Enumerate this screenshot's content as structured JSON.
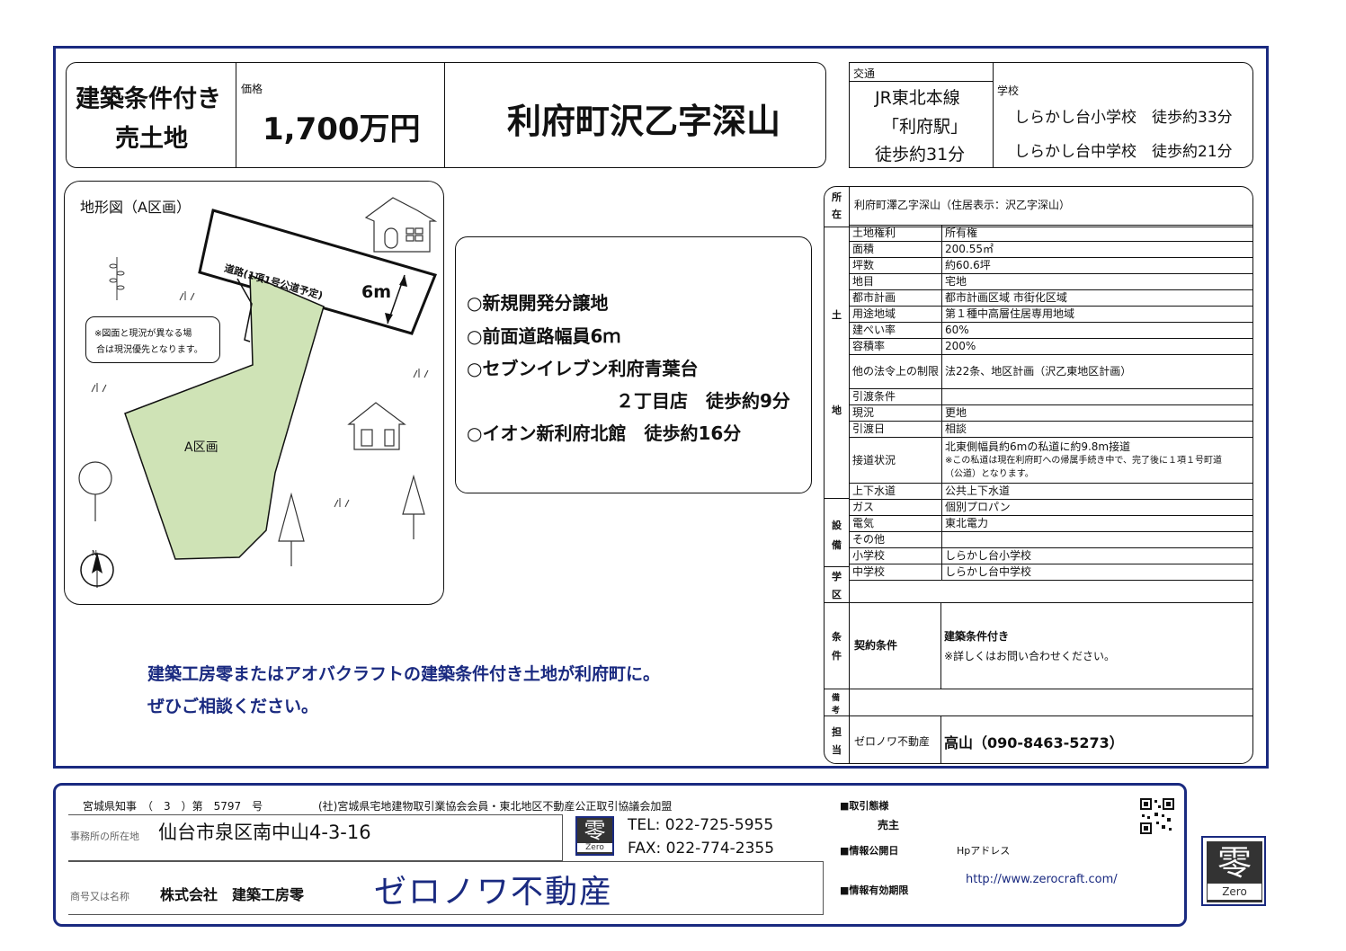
{
  "header": {
    "type_line1": "建築条件付き",
    "type_line2": "売土地",
    "price_label": "価格",
    "price": "1,700万円",
    "location_title": "利府町沢乙字深山",
    "transport_label": "交通",
    "transport_line1": "JR東北本線",
    "transport_line2": "「利府駅」",
    "transport_line3": "徒歩約31分",
    "school_label": "学校",
    "school_line1": "しらかし台小学校　徒歩約33分",
    "school_line2": "しらかし台中学校　徒歩約21分"
  },
  "map": {
    "title": "地形図（A区画）",
    "road_label": "道路(1項1号公道予定)",
    "road_width": "6m",
    "note_line1": "※図面と現況が異なる場",
    "note_line2": "合は現況優先となります。",
    "lot_label": "A区画",
    "north_label": "N"
  },
  "features": [
    "○新規開発分譲地",
    "○前面道路幅員6ｍ",
    "○セブンイレブン利府青葉台",
    "２丁目店　徒歩約9分",
    "○イオン新利府北館　徒歩約16分"
  ],
  "promo": {
    "line1": "建築工房零またはアオバクラフトの建築条件付き土地が利府町に。",
    "line2": "ぜひご相談ください。"
  },
  "spec": {
    "location_label_a": "所",
    "location_label_b": "在",
    "location_value": "利府町澤乙字深山（住居表示：沢乙字深山）",
    "land_group_label_a": "土",
    "land_group_label_b": "地",
    "land_rows": [
      {
        "label": "土地権利",
        "value": "所有権"
      },
      {
        "label": "面積",
        "value": "200.55㎡"
      },
      {
        "label": "坪数",
        "value": "約60.6坪"
      },
      {
        "label": "地目",
        "value": "宅地"
      },
      {
        "label": "都市計画",
        "value": "都市計画区域 市街化区域"
      },
      {
        "label": "用途地域",
        "value": "第１種中高層住居専用地域"
      },
      {
        "label": "建ぺい率",
        "value": "60%"
      },
      {
        "label": "容積率",
        "value": "200%"
      },
      {
        "label": "他の法令上の制限",
        "value": "法22条、地区計画（沢乙東地区計画）"
      },
      {
        "label": "引渡条件",
        "value": ""
      },
      {
        "label": "現況",
        "value": "更地"
      },
      {
        "label": "引渡日",
        "value": "相談"
      }
    ],
    "access_label": "接道状況",
    "access_line1": "北東側幅員約6mの私道に約9.8m接道",
    "access_line2": "※この私道は現在利府町への帰属手続き中で、完了後に１項１号町道",
    "access_line3": "（公道）となります。",
    "utility_group_label_a": "設",
    "utility_group_label_b": "備",
    "utility_rows": [
      {
        "label": "上下水道",
        "value": "公共上下水道"
      },
      {
        "label": "ガス",
        "value": "個別プロパン"
      },
      {
        "label": "電気",
        "value": "東北電力"
      },
      {
        "label": "その他",
        "value": ""
      }
    ],
    "school_group_label_a": "学",
    "school_group_label_b": "区",
    "school_rows": [
      {
        "label": "小学校",
        "value": "しらかし台小学校"
      },
      {
        "label": "中学校",
        "value": "しらかし台中学校"
      }
    ],
    "cond_group_label_a": "条",
    "cond_group_label_b": "件",
    "cond_label": "契約条件",
    "cond_line1": "建築条件付き",
    "cond_line2": "※詳しくはお問い合わせください。",
    "remarks_label_a": "備",
    "remarks_label_b": "考",
    "contact_label_a": "担",
    "contact_label_b": "当",
    "contact_company": "ゼロノワ不動産",
    "contact_person": "高山（090-8463-5273）"
  },
  "footer": {
    "license_prefix": "宮城県知事　（　3　）第　5797　号",
    "license_assoc": "(社)宮城県宅地建物取引業協会会員・東北地区不動産公正取引協議会加盟",
    "office_label": "事務所の所在地",
    "office_address": "仙台市泉区南中山4-3-16",
    "tel": "TEL: 022-725-5955",
    "fax": "FAX: 022-774-2355",
    "name_label": "商号又は名称",
    "company": "株式会社　建築工房零",
    "brand": "ゼロノワ不動産",
    "deal_label": "■取引態様",
    "deal_value": "売主",
    "info_date_label": "■情報公開日",
    "hp_label": "Hpアドレス",
    "info_valid_label": "■情報有効期限",
    "url": "http://www.zerocraft.com/",
    "logo_kanji": "零",
    "logo_text": "Zero"
  },
  "colors": {
    "frame": "#1a2a80",
    "lot_fill": "#cfe3b6",
    "promo_text": "#1a2a80"
  }
}
